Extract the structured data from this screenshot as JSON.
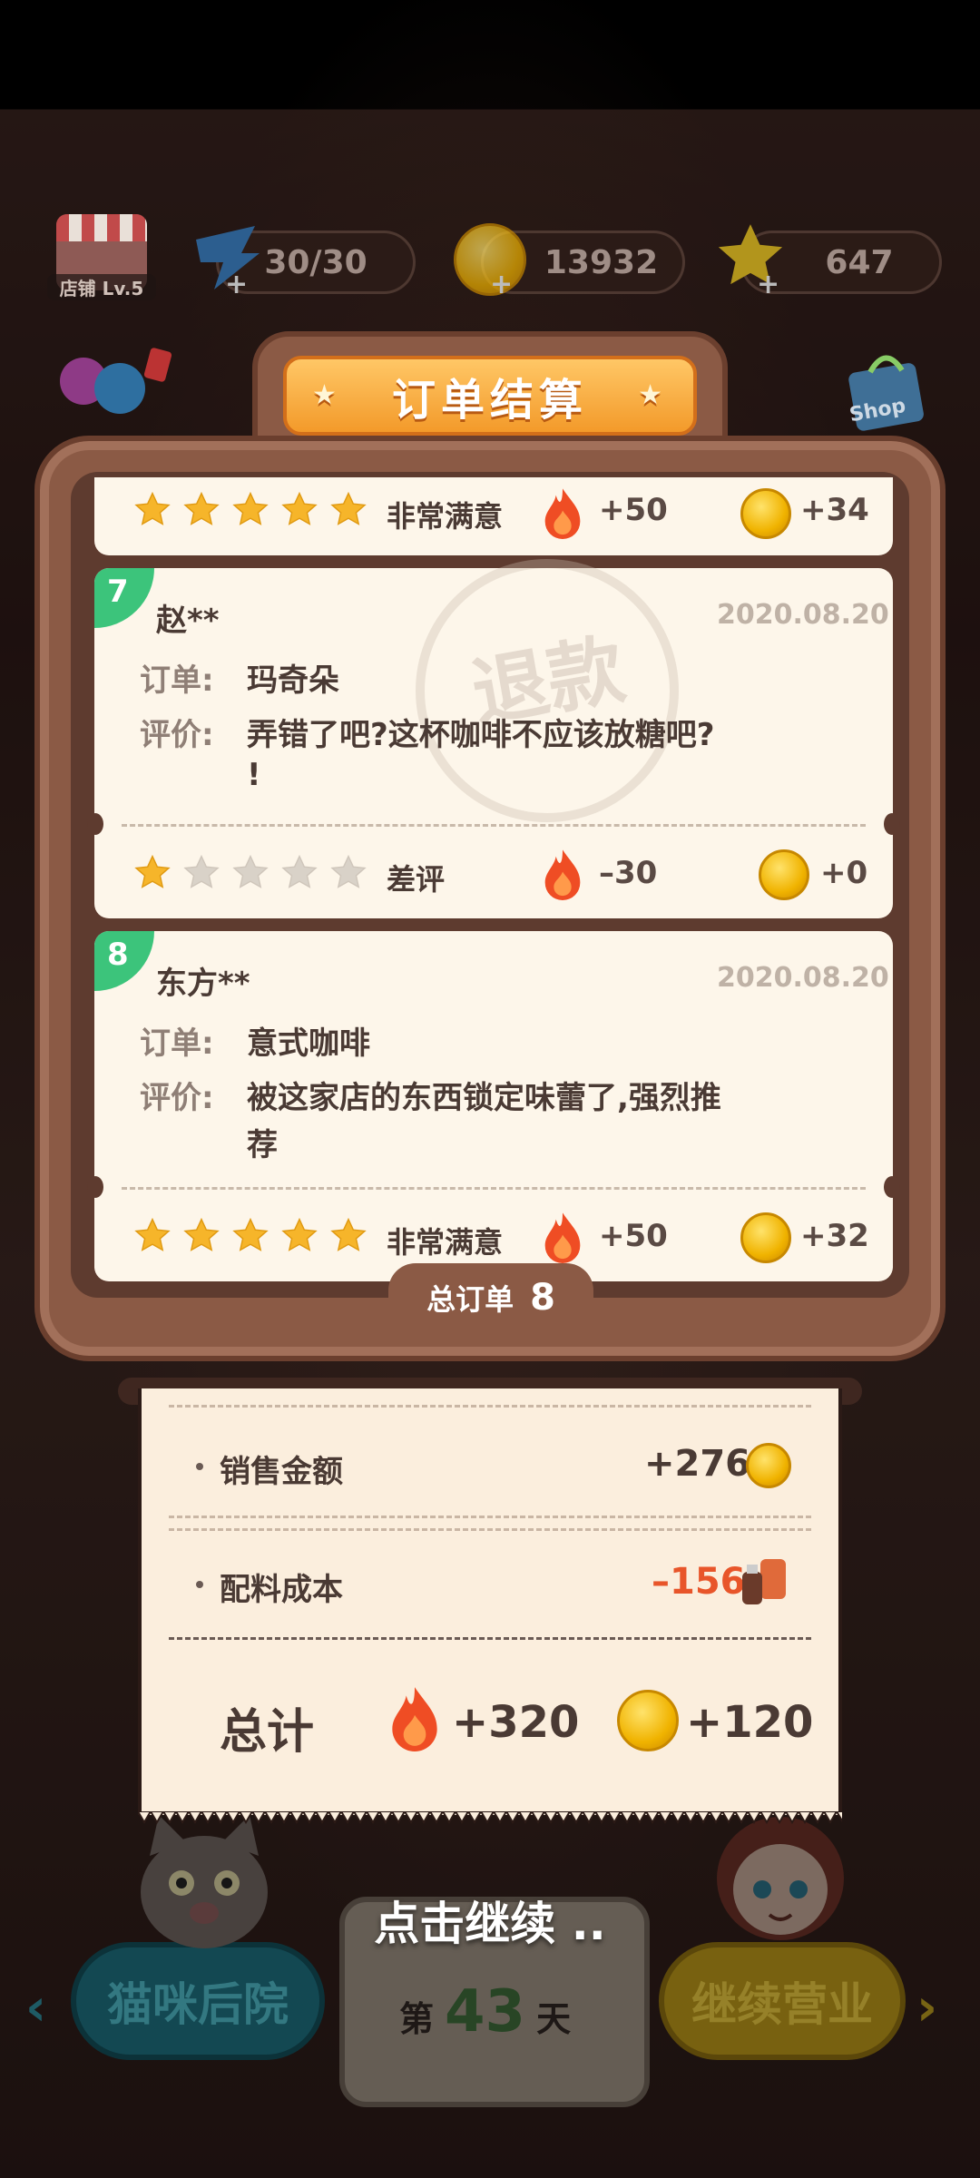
{
  "status_bar": {},
  "resources": {
    "shop_level": "店铺 Lv.5",
    "energy": "30/30",
    "coins": "13932",
    "stars": "647",
    "shop_label": "Shop"
  },
  "panel": {
    "title": "订单结算",
    "total_orders_label": "总订单",
    "total_orders_value": "8"
  },
  "orders": [
    {
      "partial": true,
      "rating_stars": 5,
      "rating_label": "非常满意",
      "heat": "+50",
      "coins": "+34"
    },
    {
      "index": "7",
      "customer": "赵**",
      "date": "2020.08.20",
      "order_label": "订单:",
      "order_item": "玛奇朵",
      "review_label": "评价:",
      "review_line1": "弄错了吧?这杯咖啡不应该放糖吧?",
      "review_line2": "!",
      "stamp": "退款",
      "rating_stars": 1,
      "rating_label": "差评",
      "heat": "–30",
      "coins": "+0"
    },
    {
      "index": "8",
      "customer": "东方**",
      "date": "2020.08.20",
      "order_label": "订单:",
      "order_item": "意式咖啡",
      "review_label": "评价:",
      "review_line1": "被这家店的东西锁定味蕾了,强烈推",
      "review_line2": "荐",
      "rating_stars": 5,
      "rating_label": "非常满意",
      "heat": "+50",
      "coins": "+32"
    }
  ],
  "receipt": {
    "sales_label": "销售金额",
    "sales_value": "+276",
    "cost_label": "配料成本",
    "cost_value": "–156",
    "total_label": "总计",
    "total_heat": "+320",
    "total_coins": "+120"
  },
  "bottom": {
    "continue_hint": "点击继续 ..",
    "left_button": "猫咪后院",
    "day_prefix": "第",
    "day_number": "43",
    "day_suffix": "天",
    "right_button": "继续营业"
  },
  "colors": {
    "accent_orange": "#f39a2a",
    "negative_red": "#e8552a",
    "badge_green": "#3cc47b",
    "panel_brown": "#8b5a45"
  }
}
